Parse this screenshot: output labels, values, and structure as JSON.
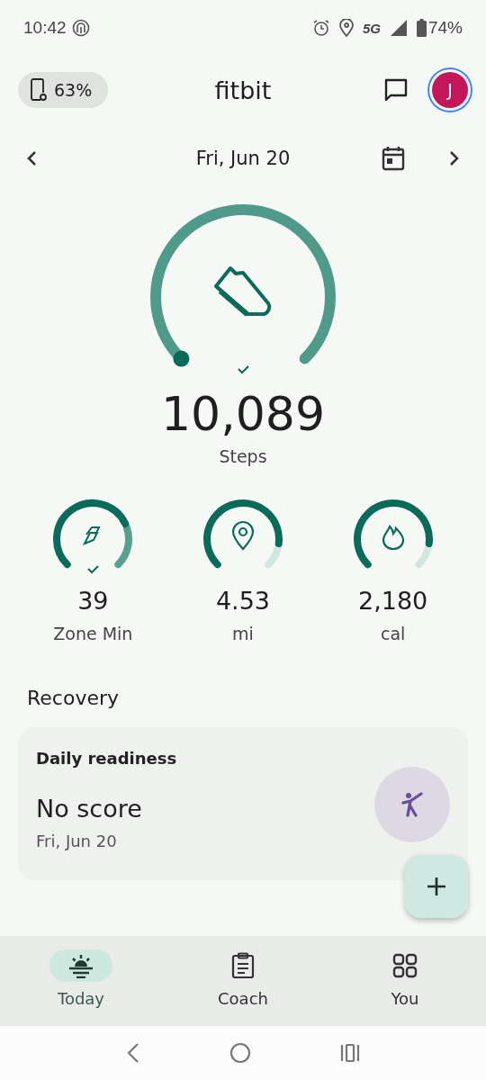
{
  "status_bar": {
    "time": "10:42",
    "network": "5G",
    "battery": "74%"
  },
  "header": {
    "device_battery": "63%",
    "title": "fitbit",
    "avatar_letter": "J"
  },
  "date_nav": {
    "date": "Fri, Jun 20"
  },
  "steps": {
    "value": "10,089",
    "label": "Steps",
    "goal_met": true
  },
  "stats": [
    {
      "kind": "zone",
      "value": "39",
      "label": "Zone Min",
      "goal_met": true
    },
    {
      "kind": "distance",
      "value": "4.53",
      "label": "mi",
      "goal_met": false
    },
    {
      "kind": "calories",
      "value": "2,180",
      "label": "cal",
      "goal_met": false
    }
  ],
  "section_title": "Recovery",
  "readiness_card": {
    "title": "Daily readiness",
    "score": "No score",
    "date": "Fri, Jun 20"
  },
  "bottom_nav": [
    {
      "kind": "today",
      "label": "Today",
      "selected": true
    },
    {
      "kind": "coach",
      "label": "Coach",
      "selected": false
    },
    {
      "kind": "you",
      "label": "You",
      "selected": false
    }
  ]
}
